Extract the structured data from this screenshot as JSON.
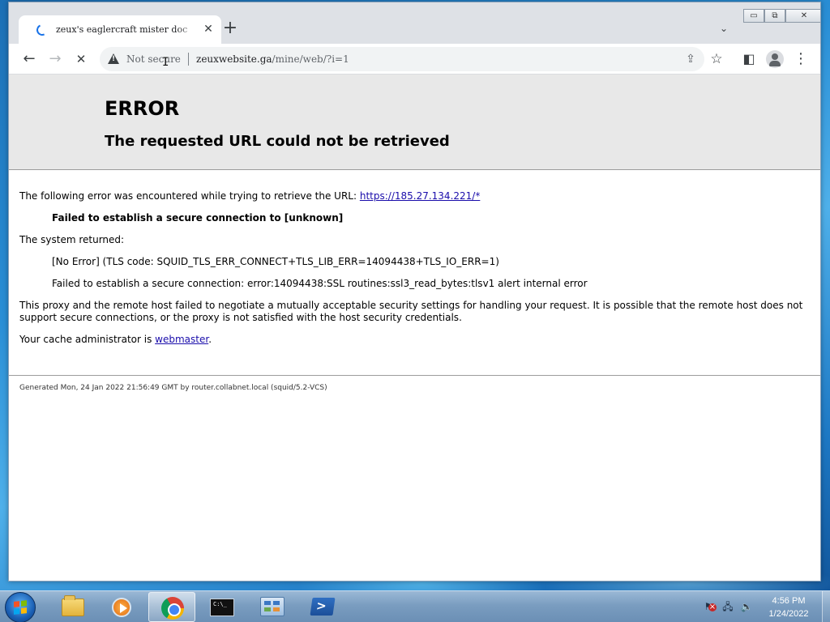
{
  "browser": {
    "tab": {
      "title": "zeux's eaglercraft mister doc",
      "close_glyph": "✕"
    },
    "new_tab_glyph": "+",
    "tab_search_glyph": "⌄",
    "window_controls": {
      "minimize": "▭",
      "restore": "⧉",
      "close": "✕"
    },
    "toolbar": {
      "back_glyph": "←",
      "forward_glyph": "→",
      "stop_glyph": "✕",
      "security_label": "Not secure",
      "url_host": "zeuxwebsite.ga",
      "url_path": "/mine/web/?i=1",
      "share_glyph": "⇪",
      "bookmark_glyph": "☆",
      "sidepanel_glyph": "◧",
      "menu_glyph": "⋮"
    }
  },
  "page": {
    "title": "ERROR",
    "subtitle": "The requested URL could not be retrieved",
    "intro_text": "The following error was encountered while trying to retrieve the URL: ",
    "intro_link": "https://185.27.134.221/*",
    "error_heading": "Failed to establish a secure connection to [unknown]",
    "system_returned_label": "The system returned:",
    "system_error_1": "[No Error] (TLS code: SQUID_TLS_ERR_CONNECT+TLS_LIB_ERR=14094438+TLS_IO_ERR=1)",
    "system_error_2": "Failed to establish a secure connection: error:14094438:SSL routines:ssl3_read_bytes:tlsv1 alert internal error",
    "explanation": "This proxy and the remote host failed to negotiate a mutually acceptable security settings for handling your request. It is possible that the remote host does not support secure connections, or the proxy is not satisfied with the host security credentials.",
    "admin_prefix": "Your cache administrator is ",
    "admin_link": "webmaster",
    "admin_suffix": ".",
    "footer": "Generated Mon, 24 Jan 2022 21:56:49 GMT by router.collabnet.local (squid/5.2-VCS)"
  },
  "taskbar": {
    "items": [
      {
        "name": "windows-explorer",
        "icon": "folder-icon"
      },
      {
        "name": "media-player",
        "icon": "media-player-icon"
      },
      {
        "name": "chrome",
        "icon": "chrome-icon",
        "active": true
      },
      {
        "name": "command-prompt",
        "icon": "cmd-icon"
      },
      {
        "name": "control-panel",
        "icon": "control-panel-icon"
      },
      {
        "name": "powershell",
        "icon": "powershell-icon"
      }
    ],
    "clock": {
      "time": "4:56 PM",
      "date": "1/24/2022"
    }
  },
  "colors": {
    "link": "#1a0dab",
    "header_bg": "#e8e8e8",
    "chrome_accent": "#1a73e8"
  }
}
